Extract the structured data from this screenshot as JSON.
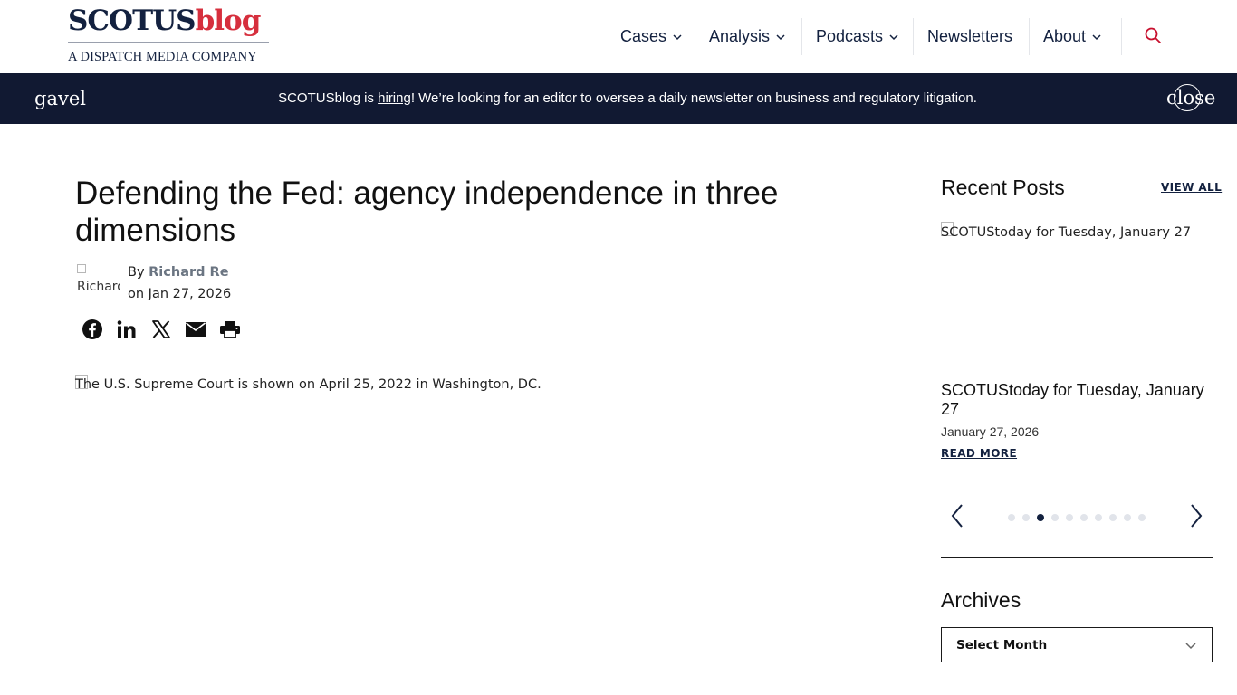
{
  "header": {
    "logo": {
      "main_dark": "SCOTUS",
      "main_red": "blog",
      "subtitle": "A DISPATCH MEDIA COMPANY"
    },
    "nav": [
      {
        "label": "Cases",
        "has_dropdown": true
      },
      {
        "label": "Analysis",
        "has_dropdown": true
      },
      {
        "label": "Podcasts",
        "has_dropdown": true
      },
      {
        "label": "Newsletters",
        "has_dropdown": false
      },
      {
        "label": "About",
        "has_dropdown": true
      }
    ],
    "search_icon": "search-icon"
  },
  "banner": {
    "icon_text": "gavel",
    "text_before": "SCOTUSblog is ",
    "link_text": "hiring",
    "text_after": "! We’re looking for an editor to oversee a daily newsletter on business and regulatory litigation.",
    "close_text": "close"
  },
  "article": {
    "title": "Defending the Fed: agency independence in three dimensions",
    "avatar_alt": "Richard Re",
    "by_label": "By ",
    "author": "Richard Re",
    "date_prefix": "on ",
    "date": "Jan 27, 2026",
    "share": [
      "facebook-icon",
      "linkedin-icon",
      "x-icon",
      "email-icon",
      "print-icon"
    ],
    "hero_alt": "The U.S. Supreme Court is shown on April 25, 2022 in Washington, DC."
  },
  "sidebar": {
    "recent_posts": {
      "heading": "Recent Posts",
      "view_all": "VIEW ALL",
      "image_alt": "SCOTUStoday for Tuesday, January 27",
      "title": "SCOTUStoday for Tuesday, January 27",
      "date": "January 27, 2026",
      "read_more": "READ MORE",
      "dots_total": 10,
      "active_dot": 3
    },
    "archives": {
      "heading": "Archives",
      "select_value": "Select Month"
    }
  },
  "colors": {
    "navy": "#13213f",
    "brand_red": "#d62f3d",
    "banner_bg": "#111932",
    "search_red": "#c8102e"
  }
}
